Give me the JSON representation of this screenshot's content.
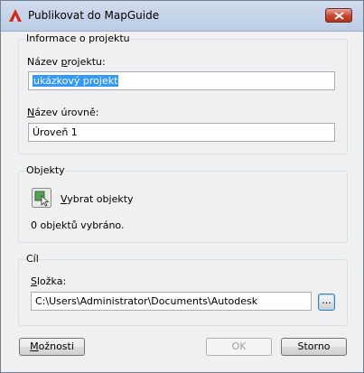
{
  "window": {
    "title": "Publikovat do MapGuide"
  },
  "project_group": {
    "title": "Informace o projektu",
    "project_name_label_pre": "Název ",
    "project_name_label_key": "p",
    "project_name_label_post": "rojektu:",
    "project_name_value": "ukázkový projekt",
    "level_name_label_key": "N",
    "level_name_label_post": "ázev úrovně:",
    "level_name_value": "Úroveň 1"
  },
  "objects_group": {
    "title": "Objekty",
    "select_label_key": "V",
    "select_label_post": "ybrat objekty",
    "selected_count_text": "0 objektů vybráno."
  },
  "target_group": {
    "title": "Cíl",
    "folder_label_key": "S",
    "folder_label_post": "ložka:",
    "folder_value": "C:\\Users\\Administrator\\Documents\\Autodesk",
    "browse_label": "..."
  },
  "buttons": {
    "options_key": "M",
    "options_post": "ožnosti",
    "ok_label": "OK",
    "cancel_label": "Storno"
  },
  "colors": {
    "selection": "#3399ff",
    "close_button": "#c7432c"
  }
}
